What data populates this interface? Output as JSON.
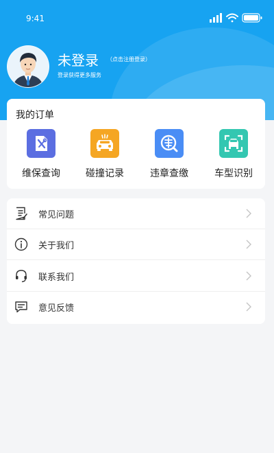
{
  "status_bar": {
    "time": "9:41",
    "icons": [
      "cellular-signal-icon",
      "wifi-icon",
      "battery-icon"
    ]
  },
  "profile": {
    "title": "未登录",
    "login_hint": "（点击注册登录）",
    "subtitle": "登录获得更多服务"
  },
  "orders": {
    "title": "我的订单",
    "items": [
      {
        "label": "维保查询",
        "icon": "wrench-screwdriver-icon",
        "color": "#5b6ee1"
      },
      {
        "label": "碰撞记录",
        "icon": "car-collision-icon",
        "color": "#f5a623"
      },
      {
        "label": "违章查缴",
        "icon": "violation-search-icon",
        "color": "#4a8df5"
      },
      {
        "label": "车型识别",
        "icon": "car-scan-icon",
        "color": "#33c7b1"
      }
    ]
  },
  "menu": {
    "items": [
      {
        "label": "常见问题",
        "icon": "faq-document-icon"
      },
      {
        "label": "关于我们",
        "icon": "info-icon"
      },
      {
        "label": "联系我们",
        "icon": "headset-icon"
      },
      {
        "label": "意见反馈",
        "icon": "feedback-message-icon"
      }
    ]
  },
  "colors": {
    "header_blue": "#17a3f1",
    "background": "#f4f5f7"
  }
}
